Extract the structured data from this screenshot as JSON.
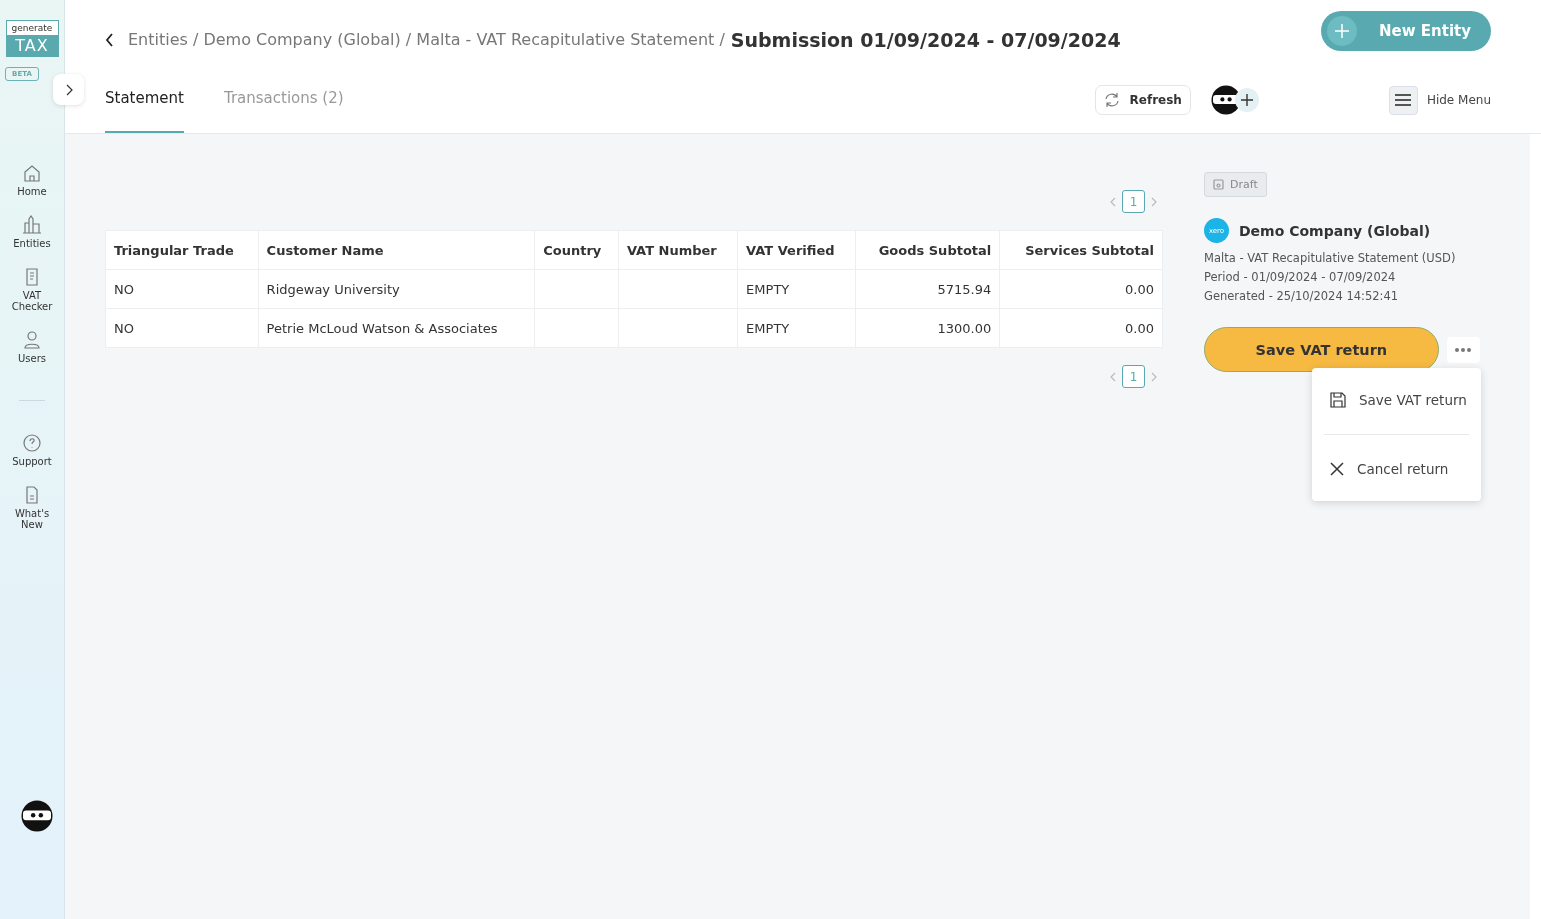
{
  "sidebar": {
    "logo_top": "generate",
    "logo_bottom": "TAX",
    "badge": "BETA",
    "items": [
      {
        "label": "Home"
      },
      {
        "label": "Entities"
      },
      {
        "label": "VAT Checker"
      },
      {
        "label": "Users"
      }
    ],
    "bottom_items": [
      {
        "label": "Support"
      },
      {
        "label": "What's New"
      }
    ]
  },
  "breadcrumb": {
    "path": "Entities / Demo Company (Global) / Malta - VAT Recapitulative Statement /",
    "current": "Submission 01/09/2024 - 07/09/2024"
  },
  "new_button": "New Entity",
  "tabs": [
    {
      "label": "Statement",
      "selected": true
    },
    {
      "label": "Transactions (2)",
      "selected": false
    }
  ],
  "refresh_button": "Refresh",
  "hide_menu": "Hide Menu",
  "pagination_top": {
    "page": "1"
  },
  "table": {
    "columns": [
      "Triangular Trade",
      "Customer Name",
      "Country",
      "VAT Number",
      "VAT Verified",
      "Goods Subtotal",
      "Services Subtotal"
    ],
    "rows": [
      [
        "NO",
        "Ridgeway University",
        "",
        "",
        "EMPTY",
        "5715.94",
        "0.00"
      ],
      [
        "NO",
        "Petrie McLoud Watson & Associates",
        "",
        "",
        "EMPTY",
        "1300.00",
        "0.00"
      ]
    ]
  },
  "pagination_bottom": {
    "page": "1"
  },
  "panel": {
    "status": "Draft",
    "source_logo": "xero",
    "company": "Demo Company (Global)",
    "details": [
      "Malta - VAT Recapitulative Statement (USD)",
      "Period - 01/09/2024 - 07/09/2024",
      "Generated - 25/10/2024 14:52:41"
    ],
    "primary_button": "Save VAT return",
    "menu": [
      {
        "label": "Save VAT return",
        "kind": "save"
      },
      {
        "label": "Cancel return",
        "kind": "cancel"
      }
    ]
  }
}
